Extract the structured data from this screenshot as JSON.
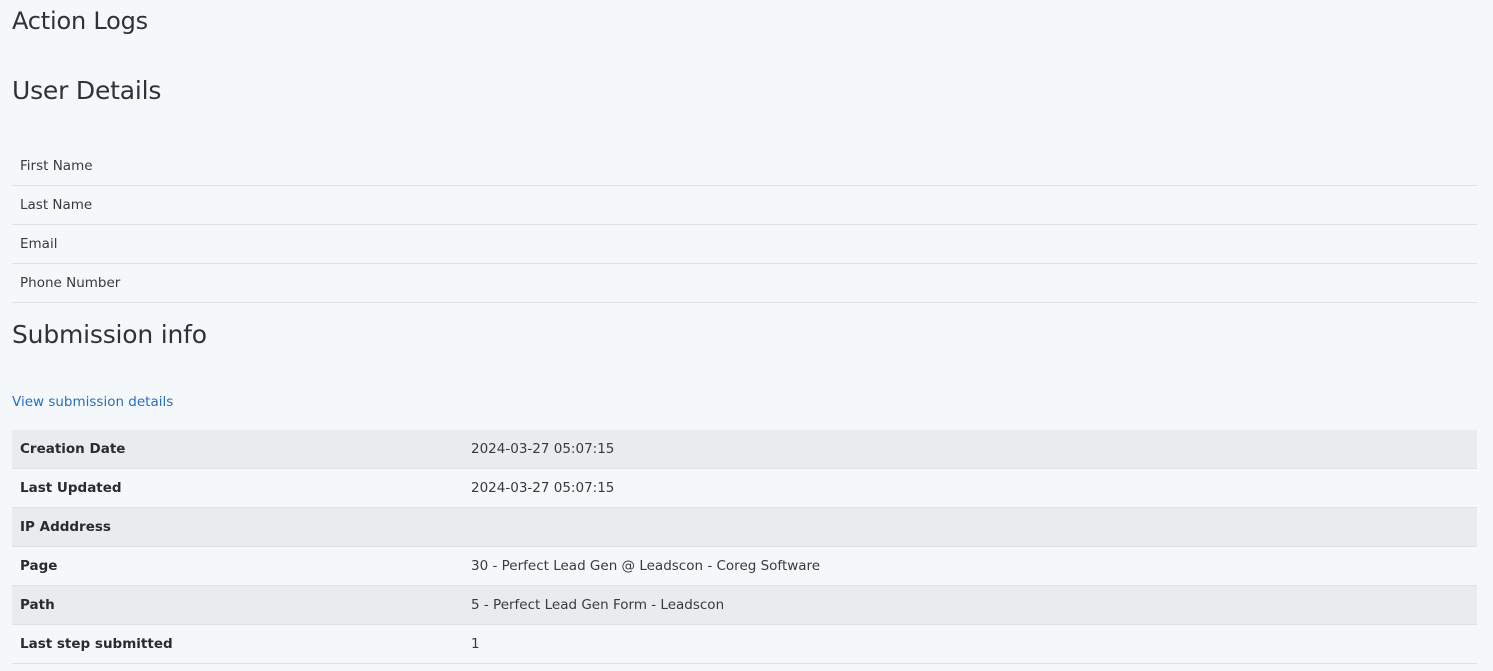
{
  "page_title": "Action Logs",
  "user_details": {
    "heading": "User Details",
    "rows": [
      {
        "label": "First Name"
      },
      {
        "label": "Last Name"
      },
      {
        "label": "Email"
      },
      {
        "label": "Phone Number"
      }
    ]
  },
  "submission_info": {
    "heading": "Submission info",
    "view_link": "View submission details",
    "rows": [
      {
        "label": "Creation Date",
        "value": "2024-03-27 05:07:15"
      },
      {
        "label": "Last Updated",
        "value": "2024-03-27 05:07:15"
      },
      {
        "label": "IP Adddress",
        "value": ""
      },
      {
        "label": "Page",
        "value": "30 - Perfect Lead Gen @ Leadscon - Coreg Software"
      },
      {
        "label": "Path",
        "value": "5 - Perfect Lead Gen Form - Leadscon"
      },
      {
        "label": "Last step submitted",
        "value": "1"
      }
    ]
  },
  "colors": {
    "background": "#f5f8fb",
    "stripe": "#e9ecef",
    "link": "#2a6ebd",
    "heading": "#2f3337"
  }
}
